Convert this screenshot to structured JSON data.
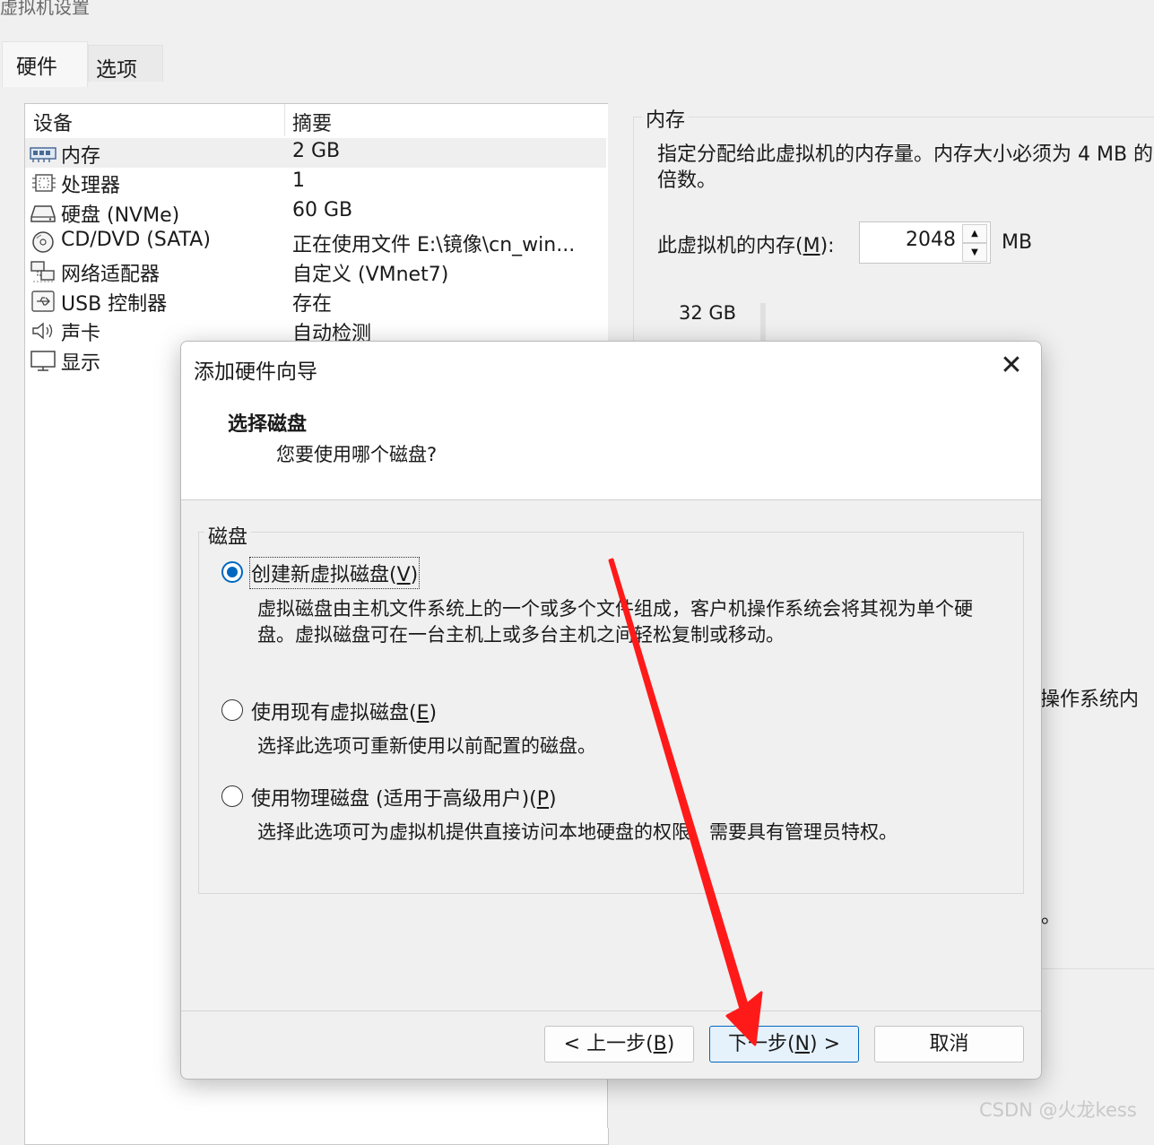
{
  "window": {
    "title": "虚拟机设置"
  },
  "tabs": [
    {
      "label": "硬件"
    },
    {
      "label": "选项"
    }
  ],
  "device_table": {
    "headers": {
      "device": "设备",
      "summary": "摘要"
    },
    "rows": [
      {
        "icon": "memory-icon",
        "name": "内存",
        "summary": "2 GB"
      },
      {
        "icon": "processor-icon",
        "name": "处理器",
        "summary": "1"
      },
      {
        "icon": "hard-disk-icon",
        "name": "硬盘 (NVMe)",
        "summary": "60 GB"
      },
      {
        "icon": "cd-dvd-icon",
        "name": "CD/DVD (SATA)",
        "summary": "正在使用文件 E:\\镜像\\cn_win..."
      },
      {
        "icon": "network-adapter-icon",
        "name": "网络适配器",
        "summary": "自定义 (VMnet7)"
      },
      {
        "icon": "usb-icon",
        "name": "USB 控制器",
        "summary": "存在"
      },
      {
        "icon": "speaker-icon",
        "name": "声卡",
        "summary": "自动检测"
      },
      {
        "icon": "display-icon",
        "name": "显示",
        "summary": ""
      }
    ]
  },
  "memory_panel": {
    "title": "内存",
    "description": "指定分配给此虚拟机的内存量。内存大小必须为 4 MB 的倍数。",
    "field_label": "此虚拟机的内存(M):",
    "value": "2048",
    "unit": "MB",
    "scale_max": "32 GB",
    "fragment_1": "操作系统内",
    "fragment_2": "。"
  },
  "dialog": {
    "title": "添加硬件向导",
    "heading": "选择磁盘",
    "subheading": "您要使用哪个磁盘?",
    "group_label": "磁盘",
    "options": [
      {
        "label": "创建新虚拟磁盘(V)",
        "description": "虚拟磁盘由主机文件系统上的一个或多个文件组成，客户机操作系统会将其视为单个硬盘。虚拟磁盘可在一台主机上或多台主机之间轻松复制或移动。",
        "checked": true
      },
      {
        "label": "使用现有虚拟磁盘(E)",
        "description": "选择此选项可重新使用以前配置的磁盘。",
        "checked": false
      },
      {
        "label": "使用物理磁盘 (适用于高级用户)(P)",
        "description": "选择此选项可为虚拟机提供直接访问本地硬盘的权限。需要具有管理员特权。",
        "checked": false
      }
    ],
    "buttons": {
      "back": "< 上一步(B)",
      "next": "下一步(N) >",
      "cancel": "取消"
    }
  },
  "watermark": "CSDN @火龙kess",
  "colors": {
    "accent": "#0067c0",
    "arrow": "#ff1a1a"
  }
}
